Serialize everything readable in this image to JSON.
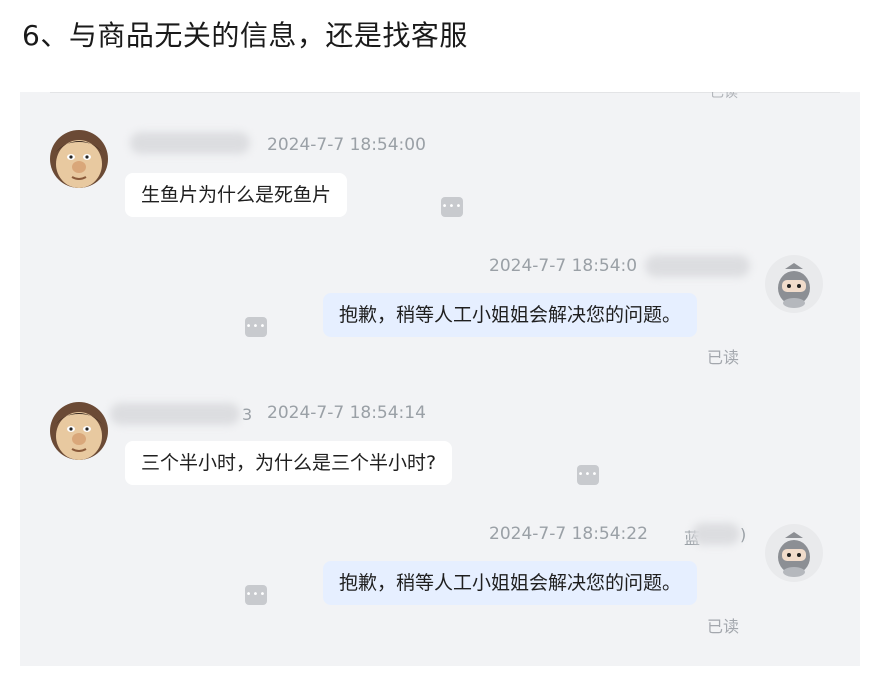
{
  "heading": "6、与商品无关的信息，还是找客服",
  "clipped_label": "已读",
  "messages": [
    {
      "side": "left",
      "time": "2024-7-7 18:54:00",
      "text": "生鱼片为什么是死鱼片"
    },
    {
      "side": "right",
      "time": "2024-7-7 18:54:0",
      "text": "抱歉，稍等人工小姐姐会解决您的问题。",
      "status": "已读"
    },
    {
      "side": "left",
      "time": "2024-7-7 18:54:14",
      "name_fragment": "3",
      "text": "三个半小时，为什么是三个半小时?"
    },
    {
      "side": "right",
      "time": "2024-7-7 18:54:22",
      "name_fragment": "蓝",
      "name_suffix": ")",
      "text": "抱歉，稍等人工小姐姐会解决您的问题。",
      "status": "已读"
    }
  ],
  "more_glyph": "•••",
  "icons": {
    "user_avatar": "cartoon-face-avatar-icon",
    "agent_avatar": "ninja-bot-avatar-icon",
    "more": "more-dots-icon"
  },
  "colors": {
    "panel_bg": "#f2f3f5",
    "bubble_left": "#ffffff",
    "bubble_right": "#e6efff",
    "timestamp": "#9aa0a6"
  }
}
